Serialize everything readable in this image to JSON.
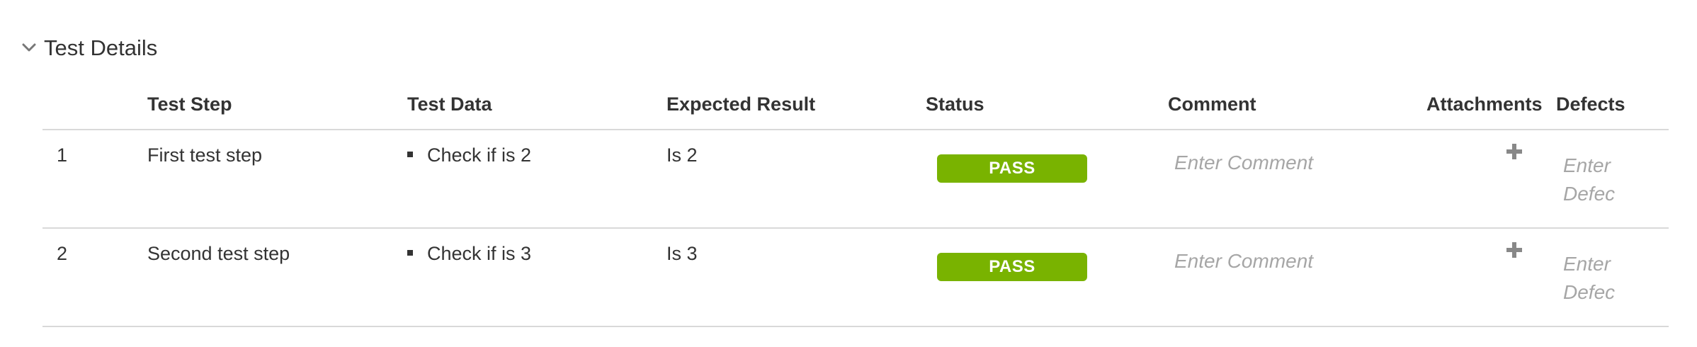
{
  "section": {
    "title": "Test Details"
  },
  "table": {
    "headers": {
      "number": "",
      "test_step": "Test Step",
      "test_data": "Test Data",
      "expected_result": "Expected Result",
      "status": "Status",
      "comment": "Comment",
      "attachments": "Attachments",
      "defects": "Defects"
    },
    "rows": [
      {
        "number": "1",
        "test_step": "First test step",
        "test_data": "Check if is 2",
        "expected_result": "Is 2",
        "status": "PASS",
        "comment_placeholder": "Enter Comment",
        "defect_placeholder": "Enter Defec"
      },
      {
        "number": "2",
        "test_step": "Second test step",
        "test_data": "Check if is 3",
        "expected_result": "Is 3",
        "status": "PASS",
        "comment_placeholder": "Enter Comment",
        "defect_placeholder": "Enter Defec"
      }
    ]
  },
  "colors": {
    "pass_badge": "#79b300",
    "divider": "#d9d9d9",
    "placeholder_text": "#a6a6a6",
    "icon_gray": "#888888"
  },
  "icons": {
    "collapse": "chevron-down-icon",
    "add_attachment": "plus-icon"
  }
}
